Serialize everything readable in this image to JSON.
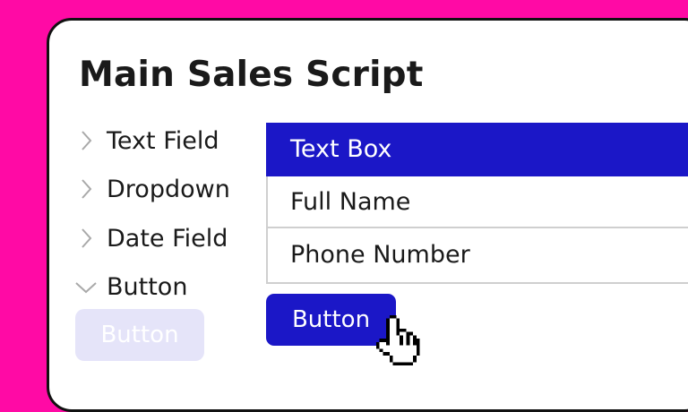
{
  "colors": {
    "background": "#ff0aa5",
    "accent": "#1b17c7",
    "ghost_button": "#e5e4f9"
  },
  "title": "Main Sales Script",
  "sidebar": {
    "items": [
      {
        "label": "Text Field",
        "icon": "chevron-right-icon",
        "expanded": false
      },
      {
        "label": "Dropdown",
        "icon": "chevron-right-icon",
        "expanded": false
      },
      {
        "label": "Date Field",
        "icon": "chevron-right-icon",
        "expanded": false
      },
      {
        "label": "Button",
        "icon": "chevron-down-icon",
        "expanded": true
      }
    ],
    "button_preview_label": "Button"
  },
  "list": {
    "rows": [
      {
        "label": "Text Box",
        "selected": true
      },
      {
        "label": "Full Name",
        "selected": false
      },
      {
        "label": "Phone Number",
        "selected": false
      }
    ]
  },
  "primary_button_label": "Button",
  "cursor_icon": "hand-pointer-icon"
}
